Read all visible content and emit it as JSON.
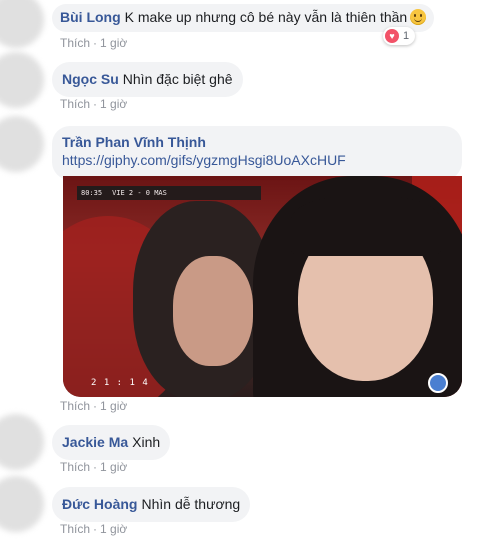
{
  "comments": [
    {
      "author": "Bùi Long",
      "text": "K make up nhưng cô bé này vẫn là thiên thần",
      "emoji": "smile-emoji",
      "reaction": {
        "icon": "heart-icon",
        "count": "1"
      },
      "actions": {
        "like": "Thích",
        "time": "1 giờ"
      }
    },
    {
      "author": "Ngọc Su",
      "text": "Nhìn đặc biệt ghê",
      "actions": {
        "like": "Thích",
        "time": "1 giờ"
      }
    },
    {
      "author": "Trần Phan Vĩnh Thịnh",
      "link": "https://giphy.com/gifs/ygzmgHsgi8UoAXcHUF",
      "gif": {
        "score": "VIE 2 - 0 MAS",
        "minute": "80:35",
        "clock": "2 1 : 1 4"
      },
      "actions": {
        "like": "Thích",
        "time": "1 giờ"
      }
    },
    {
      "author": "Jackie Ma",
      "text": "Xinh",
      "actions": {
        "like": "Thích",
        "time": "1 giờ"
      }
    },
    {
      "author": "Đức Hoàng",
      "text": "Nhìn dễ thương",
      "actions": {
        "like": "Thích",
        "time": "1 giờ"
      }
    }
  ],
  "colors": {
    "link": "#385898",
    "bubble": "#f2f3f5",
    "meta": "#90949c"
  }
}
